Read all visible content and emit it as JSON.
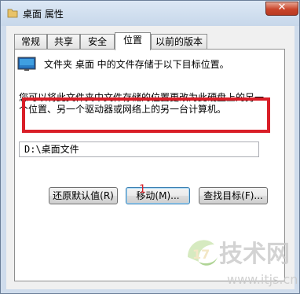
{
  "window": {
    "title": "桌面 属性",
    "close_label": "✕"
  },
  "tabs": [
    {
      "label": "常规"
    },
    {
      "label": "共享"
    },
    {
      "label": "安全"
    },
    {
      "label": "位置",
      "active": true
    },
    {
      "label": "以前的版本"
    }
  ],
  "location": {
    "folder_description": "文件夹 桌面 中的文件存储于以下目标位置。",
    "info_text": "您可以将此文件夹中文件存储的位置更改为此硬盘上的另一个位置、另一个驱动器或网络上的另一台计算机。",
    "path_value": "D:\\桌面文件"
  },
  "buttons": {
    "restore_default": "还原默认值(R)",
    "move": "移动(M)...",
    "find_target": "查找目标(F)..."
  },
  "annotation": {
    "step_number": "1"
  },
  "watermark": {
    "logo_text": "17技术网",
    "url": "www.itjs.cn"
  },
  "colors": {
    "highlight": "#d91e27",
    "titlebar": "#cfdcec",
    "close_button": "#c9452b"
  }
}
